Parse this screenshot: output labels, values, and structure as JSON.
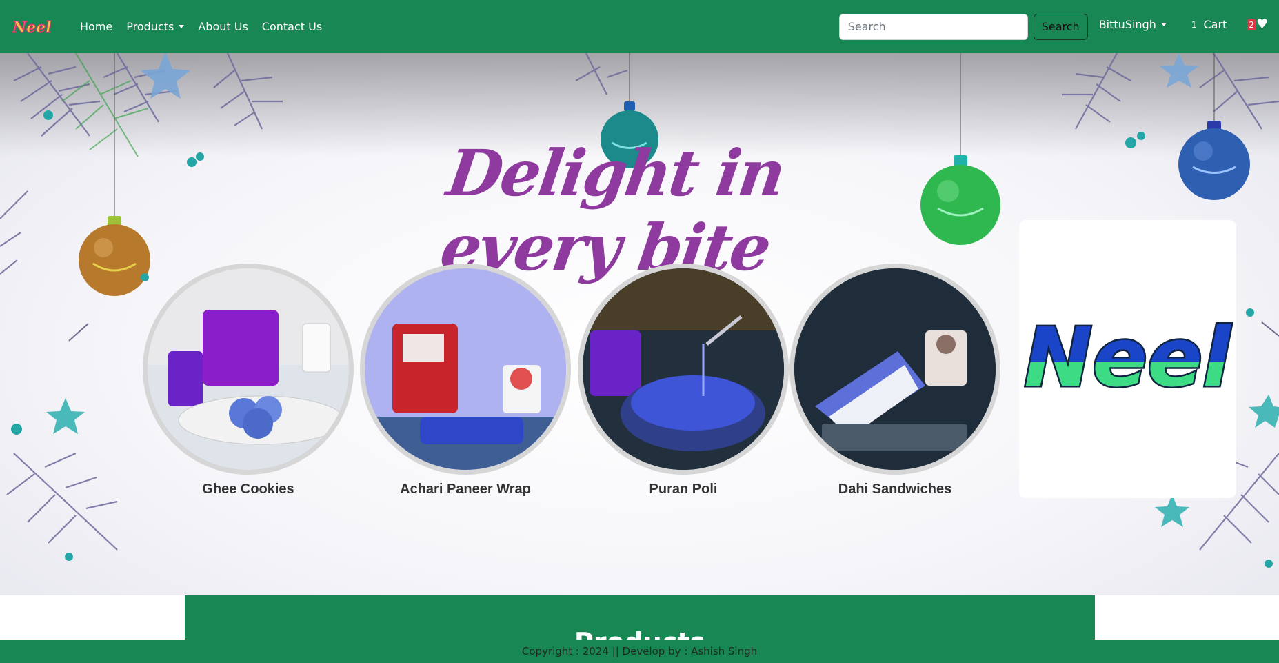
{
  "navbar": {
    "brand": "Neel",
    "links": [
      "Home",
      "Products",
      "About Us",
      "Contact Us"
    ],
    "search_placeholder": "Search",
    "search_button": "Search",
    "user": "BittuSingh",
    "cart_count": "1",
    "cart_label": "Cart",
    "wishlist_count": "2"
  },
  "hero": {
    "headline": "Delight in every bite",
    "products": [
      "Ghee Cookies",
      "Achari Paneer Wrap",
      "Puran Poli",
      "Dahi Sandwiches"
    ],
    "logo_text": "Neel"
  },
  "section": {
    "title": "Products"
  },
  "footer": {
    "text": "Copyright : 2024 || Develop by : Ashish Singh"
  },
  "colors": {
    "primary": "#198754",
    "headline": "#8e3a9e",
    "logo_blue": "#1b45c8",
    "logo_green": "#3ddc84"
  },
  "icons": [
    "chevron-down-icon",
    "heart-icon",
    "ornament-icon",
    "star-icon",
    "pine-branch-icon"
  ]
}
